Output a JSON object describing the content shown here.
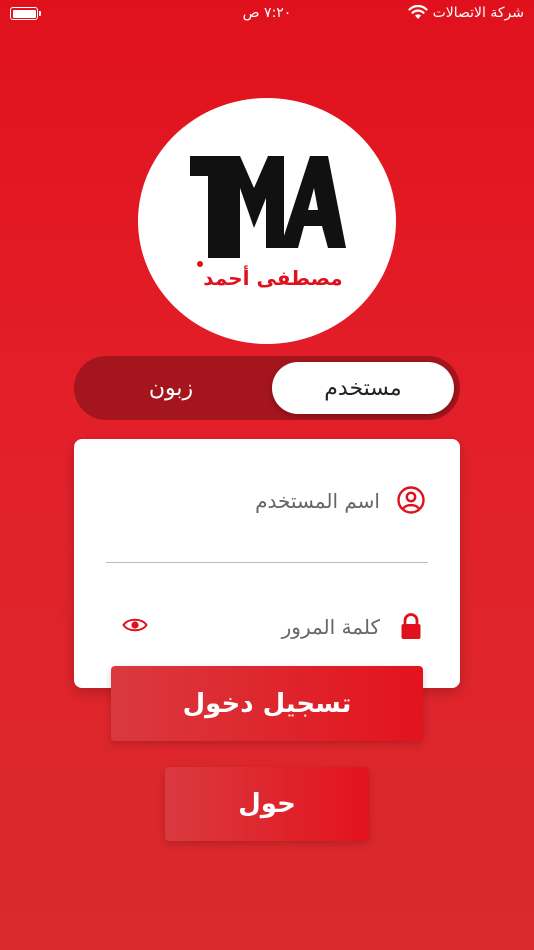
{
  "status_bar": {
    "carrier": "شركة الاتصالات",
    "time": "٧:٢٠ ص"
  },
  "logo": {
    "monogram": "MA",
    "text": "مصطفى أحمد"
  },
  "toggle": {
    "active_label": "مستخدم",
    "inactive_label": "زبون"
  },
  "form": {
    "username_placeholder": "اسم المستخدم",
    "password_placeholder": "كلمة المرور"
  },
  "buttons": {
    "login_label": "تسجيل دخول",
    "about_label": "حول"
  },
  "colors": {
    "brand_red": "#e0111c",
    "toggle_track": "#a5151d"
  },
  "icons": {
    "user": "user-circle-icon",
    "lock": "lock-icon",
    "eye": "eye-icon",
    "wifi": "wifi-icon",
    "battery": "battery-icon"
  }
}
